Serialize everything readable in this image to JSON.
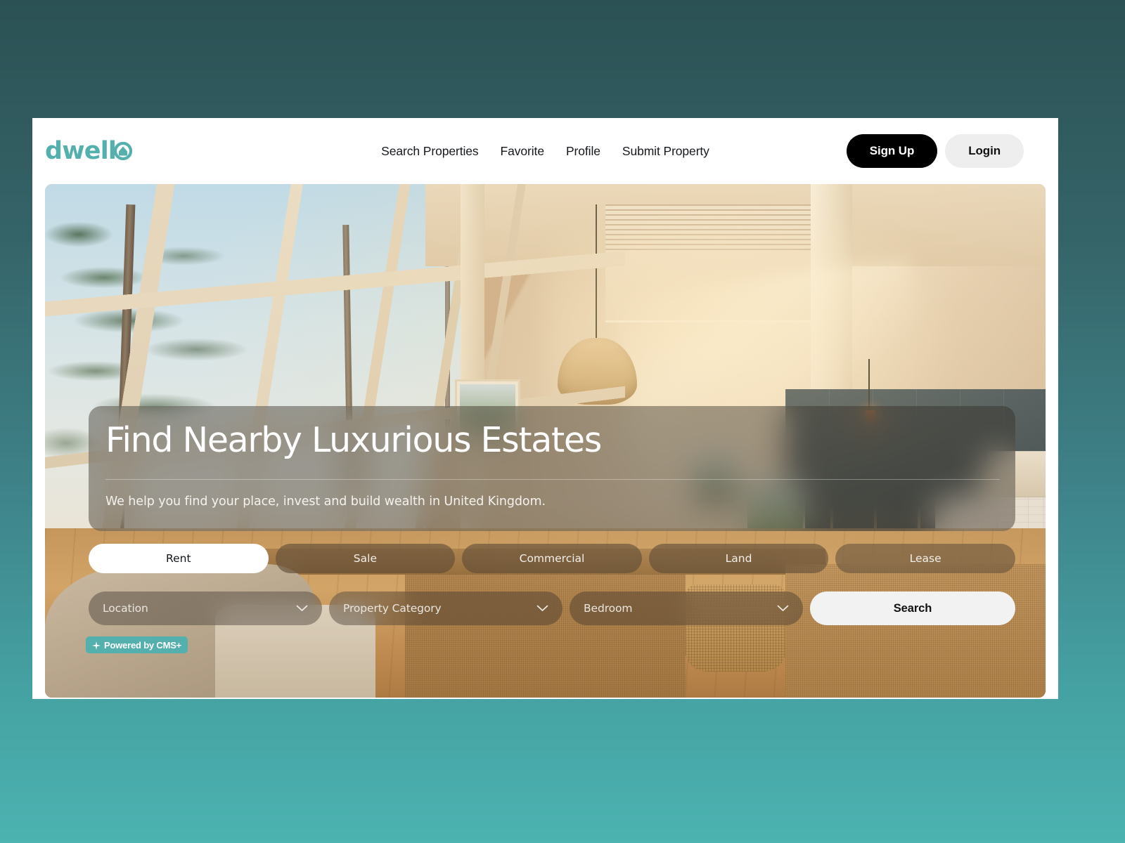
{
  "brand": {
    "name": "dwell",
    "logo_mark": "house-o-icon",
    "color": "#54b0ad"
  },
  "header": {
    "nav": [
      {
        "label": "Search Properties",
        "name": "nav-search-properties"
      },
      {
        "label": "Favorite",
        "name": "nav-favorite"
      },
      {
        "label": "Profile",
        "name": "nav-profile"
      },
      {
        "label": "Submit Property",
        "name": "nav-submit-property"
      }
    ],
    "signup_label": "Sign Up",
    "login_label": "Login"
  },
  "hero": {
    "title": "Find Nearby Luxurious Estates",
    "subtitle": "We help you find your place, invest and build wealth in United Kingdom.",
    "image_alt": "Sunlit modern living room interior with floor-to-ceiling windows overlooking pine trees, woven pendant lamp and dark navy kitchen cabinets"
  },
  "tabs": [
    {
      "label": "Rent",
      "active": true
    },
    {
      "label": "Sale",
      "active": false
    },
    {
      "label": "Commercial",
      "active": false
    },
    {
      "label": "Land",
      "active": false
    },
    {
      "label": "Lease",
      "active": false
    }
  ],
  "filters": {
    "location": {
      "label": "Location",
      "icon": "chevron-down-icon"
    },
    "category": {
      "label": "Property Category",
      "icon": "chevron-down-icon"
    },
    "bedroom": {
      "label": "Bedroom",
      "icon": "chevron-down-icon"
    },
    "search_label": "Search"
  },
  "badge": {
    "text": "Powered by CMS+",
    "icon": "sparkle-icon",
    "color": "#54b0ad"
  },
  "theme": {
    "page_bg_top": "#2b5154",
    "page_bg_bottom": "#4cb3b1",
    "card_bg": "#ffffff",
    "signup_bg": "#000000",
    "login_bg": "#eeeeee"
  }
}
